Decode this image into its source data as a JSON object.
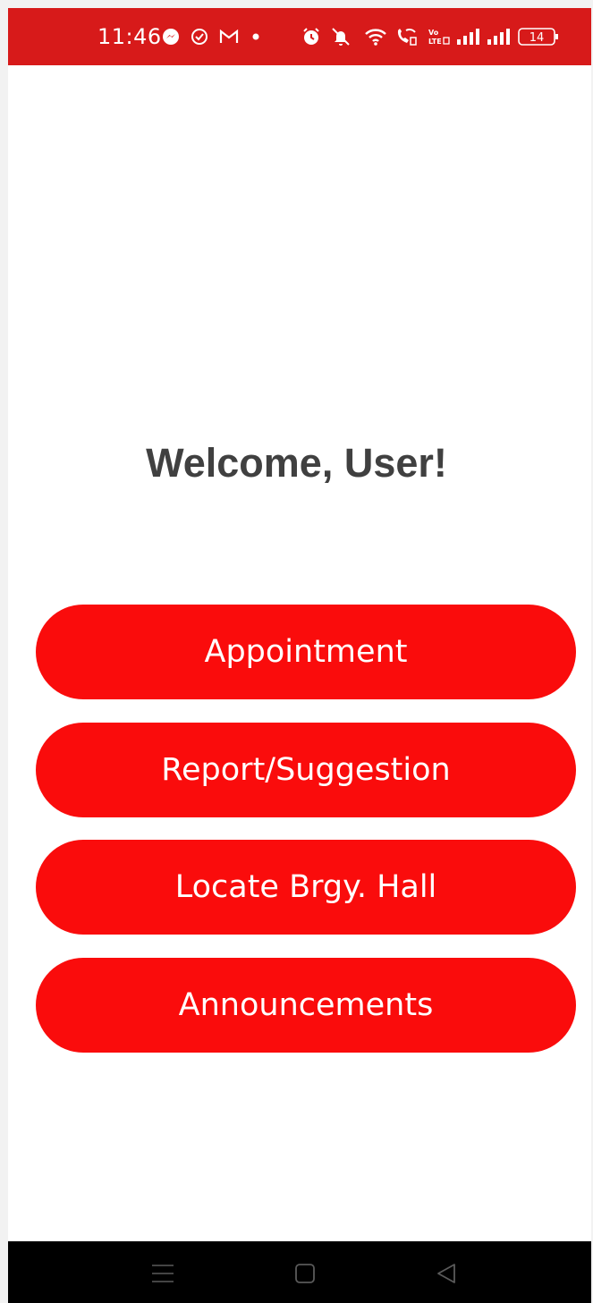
{
  "status_bar": {
    "time": "11:46",
    "battery_level": "14",
    "background_color": "#d71a1a",
    "icons": [
      "messenger-icon",
      "check-circle-icon",
      "gmail-icon",
      "dot-icon",
      "alarm-icon",
      "mute-icon",
      "wifi-icon",
      "wifi-calling-icon",
      "volte-icon",
      "signal-icon",
      "signal-icon",
      "battery-icon"
    ],
    "volte_label": "Vo LTE"
  },
  "main": {
    "welcome_text": "Welcome, User!",
    "buttons": [
      {
        "label": "Appointment"
      },
      {
        "label": "Report/Suggestion"
      },
      {
        "label": "Locate Brgy. Hall"
      },
      {
        "label": "Announcements"
      }
    ],
    "button_color": "#fa0c0c",
    "welcome_color": "#404040"
  },
  "nav_bar": {
    "buttons": [
      "menu-icon",
      "home-icon",
      "back-icon"
    ]
  }
}
